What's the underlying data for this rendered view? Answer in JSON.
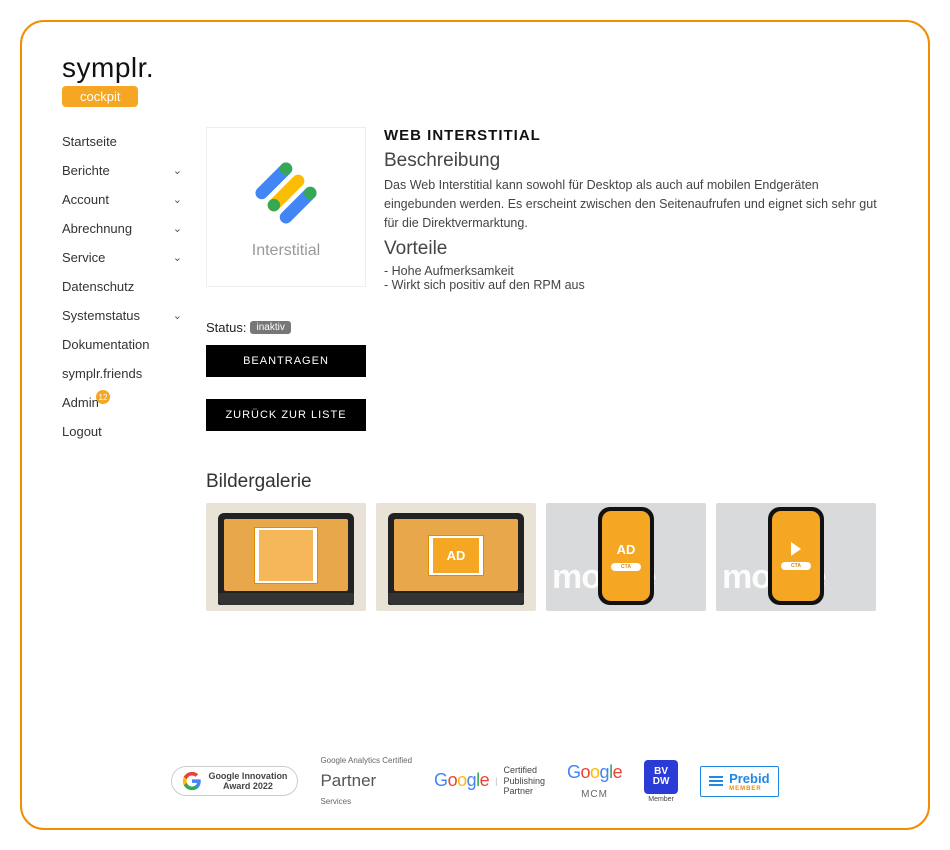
{
  "brand": {
    "name": "symplr.",
    "sub": "cockpit"
  },
  "sidebar": {
    "items": [
      {
        "label": "Startseite",
        "expandable": false
      },
      {
        "label": "Berichte",
        "expandable": true
      },
      {
        "label": "Account",
        "expandable": true
      },
      {
        "label": "Abrechnung",
        "expandable": true
      },
      {
        "label": "Service",
        "expandable": true
      },
      {
        "label": "Datenschutz",
        "expandable": false
      },
      {
        "label": "Systemstatus",
        "expandable": true
      },
      {
        "label": "Dokumentation",
        "expandable": false
      },
      {
        "label": "symplr.friends",
        "expandable": false
      },
      {
        "label": "Admin",
        "expandable": false,
        "badge": "12"
      },
      {
        "label": "Logout",
        "expandable": false
      }
    ]
  },
  "tile": {
    "label": "Interstitial"
  },
  "detail": {
    "title": "WEB INTERSTITIAL",
    "desc_heading": "Beschreibung",
    "desc_text": "Das Web Interstitial kann sowohl für Desktop als auch auf mobilen Endgeräten eingebunden werden. Es erscheint zwischen den Seitenaufrufen und eignet sich sehr gut für die Direktvermarktung.",
    "benefits_heading": "Vorteile",
    "benefits": [
      "- Hohe Aufmerksamkeit",
      "- Wirkt sich positiv auf den RPM aus"
    ]
  },
  "status": {
    "label": "Status:",
    "value": "inaktiv"
  },
  "buttons": {
    "request": "BEANTRAGEN",
    "back": "ZURÜCK ZUR LISTE"
  },
  "gallery": {
    "title": "Bildergalerie",
    "items": [
      {
        "device": "laptop",
        "ad_text": ""
      },
      {
        "device": "laptop",
        "ad_text": "AD"
      },
      {
        "device": "phone",
        "ad_text": "AD",
        "bg_text": "mobile",
        "cta": "CTA"
      },
      {
        "device": "phone",
        "ad_text": "play",
        "bg_text": "mobile",
        "cta": "CTA"
      }
    ]
  },
  "footer": {
    "innovation": {
      "line1": "Google Innovation",
      "line2": "Award 2022"
    },
    "analytics": {
      "top": "Google Analytics Certified",
      "main": "Partner",
      "sub": "Services"
    },
    "publishing": {
      "brand": "Google",
      "line1": "Certified",
      "line2": "Publishing",
      "line3": "Partner"
    },
    "mcm": {
      "brand": "Google",
      "sub": "MCM"
    },
    "bvdw": {
      "text": "BV DW",
      "sub": "Member"
    },
    "prebid": {
      "text": "Prebid",
      "sub": "MEMBER"
    }
  }
}
